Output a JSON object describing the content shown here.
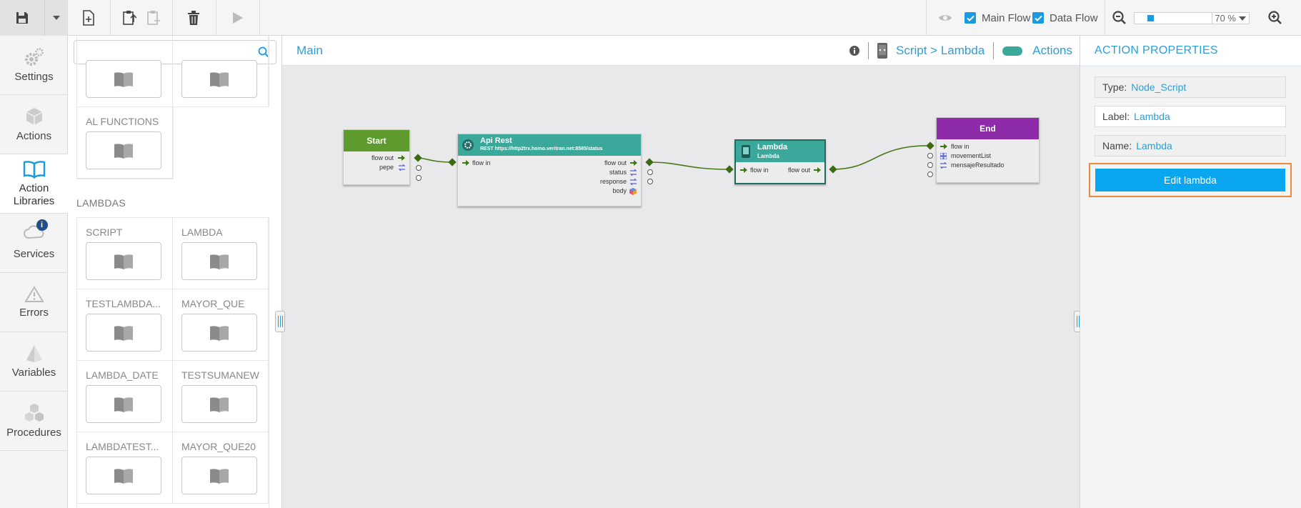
{
  "toolbar": {
    "save_icon": "floppy-disk-icon",
    "main_flow_label": "Main Flow",
    "data_flow_label": "Data Flow",
    "main_flow_checked": true,
    "data_flow_checked": true,
    "zoom_value": "70 %",
    "zoom_level": 0.7
  },
  "nav": {
    "items": [
      {
        "label": "Settings",
        "icon": "gears-icon"
      },
      {
        "label": "Actions",
        "icon": "cube-icon"
      },
      {
        "label": "Action Libraries",
        "icon": "open-book-icon",
        "active": true
      },
      {
        "label": "Services",
        "icon": "cloud-icon",
        "badge": "i"
      },
      {
        "label": "Errors",
        "icon": "warning-icon"
      },
      {
        "label": "Variables",
        "icon": "pyramid-icon"
      },
      {
        "label": "Procedures",
        "icon": "cubes-icon"
      }
    ]
  },
  "library": {
    "search_placeholder": "",
    "functions_title": "AL FUNCTIONS",
    "lambdas_title": "LAMBDAS",
    "lambdas": [
      "SCRIPT",
      "LAMBDA",
      "TESTLAMBDA...",
      "MAYOR_QUE",
      "LAMBDA_DATE",
      "TESTSUMANEW",
      "LAMBDATEST...",
      "MAYOR_QUE20"
    ]
  },
  "canvas": {
    "breadcrumb_main": "Main",
    "breadcrumb_path": "Script > Lambda",
    "actions_label": "Actions",
    "nodes": {
      "start": {
        "title": "Start",
        "ports": [
          "flow out",
          "pepe"
        ]
      },
      "api": {
        "title": "Api Rest",
        "subtitle": "REST https://http2trx.homo.veritran.net:8585/status",
        "in": "flow in",
        "outs": [
          "flow out",
          "status",
          "response",
          "body"
        ]
      },
      "lambda": {
        "title": "Lambda",
        "subtitle": "Lambda",
        "in": "flow in",
        "out": "flow out"
      },
      "end": {
        "title": "End",
        "ports": [
          "flow in",
          "movementList",
          "mensajeResultado"
        ]
      }
    }
  },
  "properties": {
    "title": "ACTION PROPERTIES",
    "type_key": "Type:",
    "type_value": "Node_Script",
    "label_key": "Label:",
    "label_value": "Lambda",
    "name_key": "Name:",
    "name_value": "Lambda",
    "edit_button": "Edit lambda"
  },
  "colors": {
    "accent": "#2b9fd8",
    "start": "#5e9b2e",
    "api": "#3aa89a",
    "lambda": "#3aa89a",
    "end": "#8e2ba8",
    "edit_button": "#0aa6f0",
    "highlight": "#ee8a3c"
  }
}
